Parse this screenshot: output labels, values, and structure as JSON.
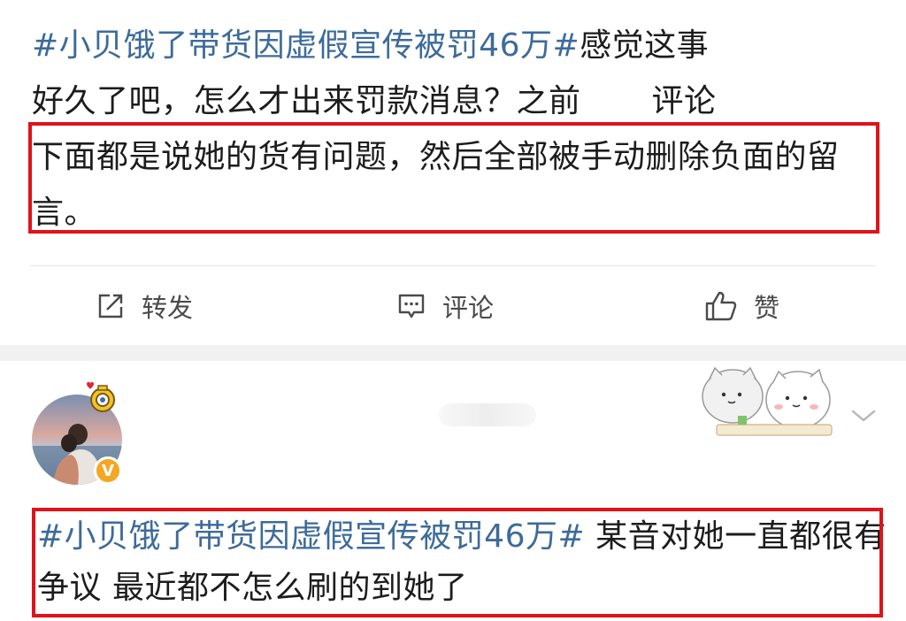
{
  "post1": {
    "hashtag": "#小贝饿了带货因虚假宣传被罚46万#",
    "text_line1_rest": "感觉这事",
    "text_line2": "好久了吧，怎么才出来罚款消息？之前",
    "text_line2_tail": "评论",
    "text_highlight": "下面都是说她的货有问题，然后全部被手动删除负面的留言。"
  },
  "actions": {
    "repost_label": "转发",
    "comment_label": "评论",
    "like_label": "赞"
  },
  "post2": {
    "hashtag": "#小贝饿了带货因虚假宣传被罚46万#",
    "text_rest": " 某音对她一直都很有争议 最近都不怎么刷的到她了",
    "verified_mark": "V"
  },
  "colors": {
    "hashtag": "#3d6b9a",
    "highlight_border": "#e0131a",
    "verified": "#f5a623"
  }
}
